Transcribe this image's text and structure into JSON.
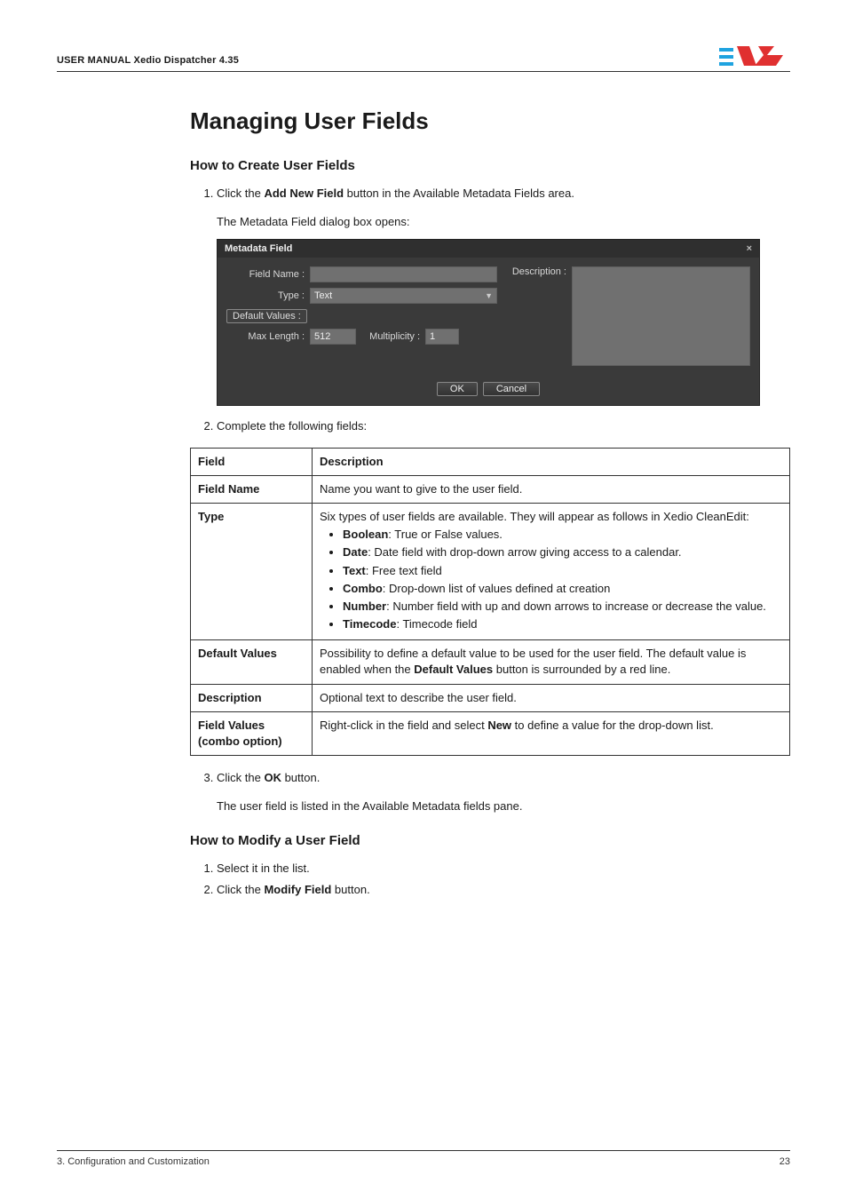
{
  "header": {
    "title": "USER MANUAL Xedio Dispatcher 4.35"
  },
  "headings": {
    "h1": "Managing User Fields",
    "h2_create": "How to Create User Fields",
    "h2_modify": "How to Modify a User Field"
  },
  "create": {
    "step1_pre": "Click the ",
    "step1_bold": "Add New Field",
    "step1_post": " button in the Available Metadata Fields area.",
    "step1_sub": "The Metadata Field dialog box opens:",
    "step2": "Complete the following fields:",
    "step3_pre": "Click the ",
    "step3_bold": "OK",
    "step3_post": " button.",
    "step3_sub": "The user field is listed in the Available Metadata fields pane."
  },
  "dialog": {
    "title": "Metadata Field",
    "close": "×",
    "labels": {
      "field_name": "Field Name :",
      "type": "Type :",
      "default_values": "Default Values :",
      "max_length": "Max Length :",
      "multiplicity": "Multiplicity :",
      "description": "Description :"
    },
    "values": {
      "type": "Text",
      "max_length": "512",
      "multiplicity": "1"
    },
    "buttons": {
      "ok": "OK",
      "cancel": "Cancel"
    }
  },
  "table": {
    "header_field": "Field",
    "header_description": "Description",
    "rows": {
      "field_name": {
        "name": "Field Name",
        "desc": "Name you want to give to the user field."
      },
      "type": {
        "name": "Type",
        "intro": "Six types of user fields are available. They will appear as follows in Xedio CleanEdit:",
        "items": {
          "boolean_b": "Boolean",
          "boolean_t": ": True or False values.",
          "date_b": "Date",
          "date_t": ": Date field with drop-down arrow giving access to a calendar.",
          "text_b": "Text",
          "text_t": ": Free text field",
          "combo_b": "Combo",
          "combo_t": ": Drop-down list of values defined at creation",
          "number_b": "Number",
          "number_t": ": Number field with up and down arrows to increase or decrease the value.",
          "timecode_b": "Timecode",
          "timecode_t": ": Timecode field"
        }
      },
      "default_values": {
        "name": "Default Values",
        "pre": "Possibility to define a default value to be used for the user field. The default value is enabled when the ",
        "bold": "Default Values",
        "post": " button is surrounded by a red line."
      },
      "description": {
        "name": "Description",
        "desc": "Optional text to describe the user field."
      },
      "field_values": {
        "name_l1": "Field Values",
        "name_l2": "(combo option)",
        "pre": "Right-click in the field and select ",
        "bold": "New",
        "post": " to define a value for the drop-down list."
      }
    }
  },
  "modify": {
    "step1": "Select it in the list.",
    "step2_pre": "Click the ",
    "step2_bold": "Modify Field",
    "step2_post": " button."
  },
  "footer": {
    "left": "3. Configuration and Customization",
    "right": "23"
  }
}
